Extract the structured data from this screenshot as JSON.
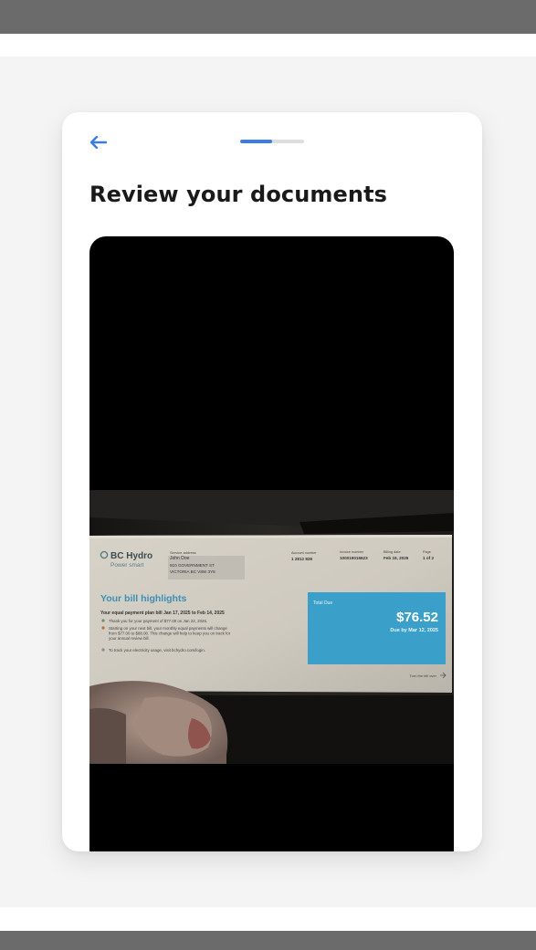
{
  "header": {
    "back_icon": "arrow-left-icon",
    "progress_fraction": 0.5,
    "accent_color": "#3b7de3"
  },
  "main": {
    "title": "Review your documents"
  },
  "document": {
    "brand_name": "BC Hydro",
    "brand_tagline": "Power smart",
    "service_address_label": "Service address",
    "customer_name": "John Doe",
    "address_line1": "910 GOVERNMENT ST",
    "address_line2": "VICTORIA BC V8W 3Y8",
    "account_number_label": "Account number",
    "account_number": "1 2812 828",
    "invoice_number_label": "Invoice number",
    "invoice_number": "100019016623",
    "billing_date_label": "Billing date",
    "billing_date": "Feb 19, 2025",
    "page_label": "Page",
    "page_value": "1 of 2",
    "highlights_title": "Your bill highlights",
    "plan_line": "Your equal payment plan bill Jan 17, 2025 to Feb 14, 2025",
    "bullet1": "Thank you for your payment of $77.00 on Jan 22, 2025.",
    "bullet2a": "Starting on your next bill, your monthly equal payments will change",
    "bullet2b": "from $77.00 to $88.00. This change will help to keep you on track for",
    "bullet2c": "your annual review bill.",
    "bullet3": "To track your electricity usage, visit bchydro.com/login.",
    "total_due_label": "Total Due",
    "total_due_amount": "$76.52",
    "due_date": "Due by Mar 12, 2025",
    "turn_page_note": "Turn the bill over",
    "total_box_color": "#3a9fc9"
  }
}
